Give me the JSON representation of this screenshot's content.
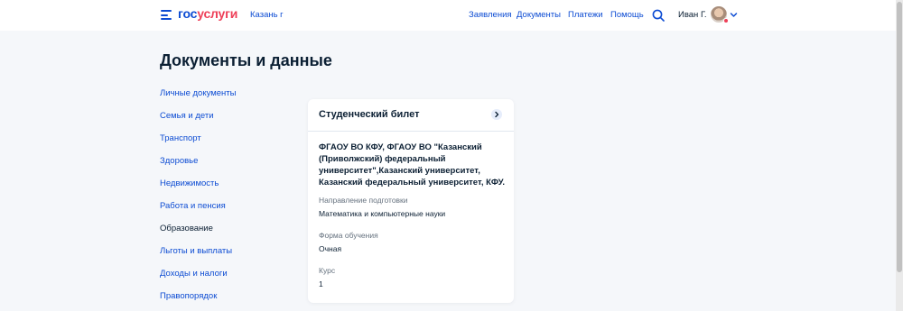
{
  "header": {
    "logo_part1": "гос",
    "logo_part2": "услуги",
    "city": "Казань г",
    "nav": [
      "Заявления",
      "Документы",
      "Платежи",
      "Помощь"
    ],
    "user_name": "Иван Г.",
    "icons": {
      "menu": "burger-icon",
      "search": "search-icon",
      "dropdown": "chevron-down-icon"
    }
  },
  "page": {
    "title": "Документы и данные"
  },
  "sidebar": {
    "items": [
      {
        "label": "Личные документы"
      },
      {
        "label": "Семья и дети"
      },
      {
        "label": "Транспорт"
      },
      {
        "label": "Здоровье"
      },
      {
        "label": "Недвижимость"
      },
      {
        "label": "Работа и пенсия"
      },
      {
        "label": "Образование",
        "active": true
      },
      {
        "label": "Льготы и выплаты"
      },
      {
        "label": "Доходы и налоги"
      },
      {
        "label": "Правопорядок"
      }
    ]
  },
  "card": {
    "title": "Студенческий билет",
    "org": "ФГАОУ ВО КФУ, ФГАОУ ВО \"Казанский (Приволжский) федеральный университет\",Казанский университет, Казанский федеральный университет, КФУ.",
    "fields": [
      {
        "label": "Направление подготовки",
        "value": "Математика и компьютерные науки"
      },
      {
        "label": "Форма обучения",
        "value": "Очная"
      },
      {
        "label": "Курс",
        "value": "1"
      }
    ]
  },
  "colors": {
    "link": "#0d4cd3",
    "brand_red": "#ee3f58",
    "text": "#0b1f33",
    "muted": "#66727f",
    "bg": "#f5f7fa"
  }
}
